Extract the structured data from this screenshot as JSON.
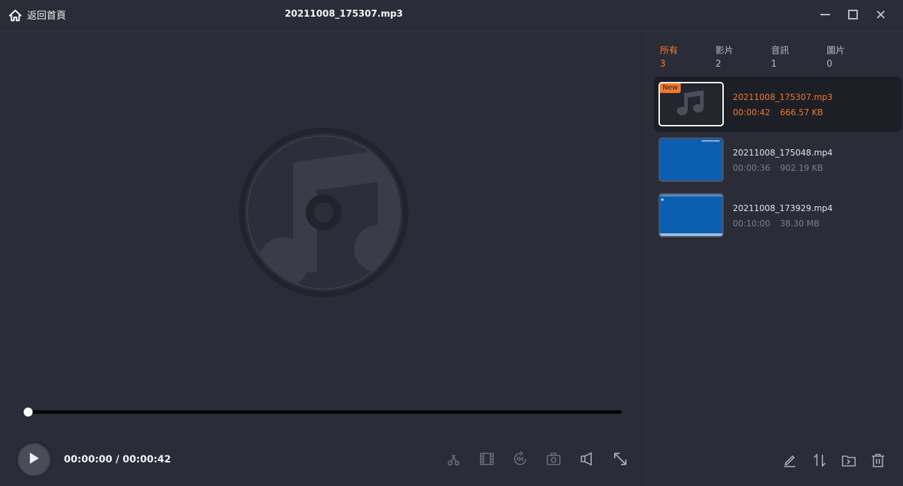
{
  "titlebar": {
    "home_label": "返回首頁",
    "file_title": "20211008_175307.mp3",
    "icons": [
      "home-icon",
      "minimize-icon",
      "maximize-icon",
      "close-icon"
    ]
  },
  "player": {
    "current_time": "00:00:00",
    "total_time": "00:00:42",
    "time_display": "00:00:00 / 00:00:42",
    "progress": 0,
    "tools": [
      "trim-icon",
      "filmstrip-icon",
      "audio-rotate-icon",
      "snapshot-icon",
      "volume-icon",
      "fullscreen-icon"
    ]
  },
  "sidebar": {
    "tabs": [
      {
        "label": "所有",
        "count": "3"
      },
      {
        "label": "影片",
        "count": "2"
      },
      {
        "label": "音訊",
        "count": "1"
      },
      {
        "label": "圖片",
        "count": "0"
      }
    ],
    "active_tab": 0,
    "items": [
      {
        "name": "20211008_175307.mp3",
        "duration": "00:00:42",
        "size": "666.57 KB",
        "badge": "New",
        "type": "audio"
      },
      {
        "name": "20211008_175048.mp4",
        "duration": "00:00:36",
        "size": "902.19 KB",
        "type": "video"
      },
      {
        "name": "20211008_173929.mp4",
        "duration": "00:10:00",
        "size": "38.30 MB",
        "type": "video"
      }
    ],
    "footer_tools": [
      "edit-icon",
      "sort-icon",
      "open-folder-icon",
      "delete-icon"
    ]
  },
  "colors": {
    "background": "#2a2c37",
    "accent": "#f2782a",
    "selected_row": "#1d1f27",
    "video_thumb": "#0c5fb0"
  }
}
